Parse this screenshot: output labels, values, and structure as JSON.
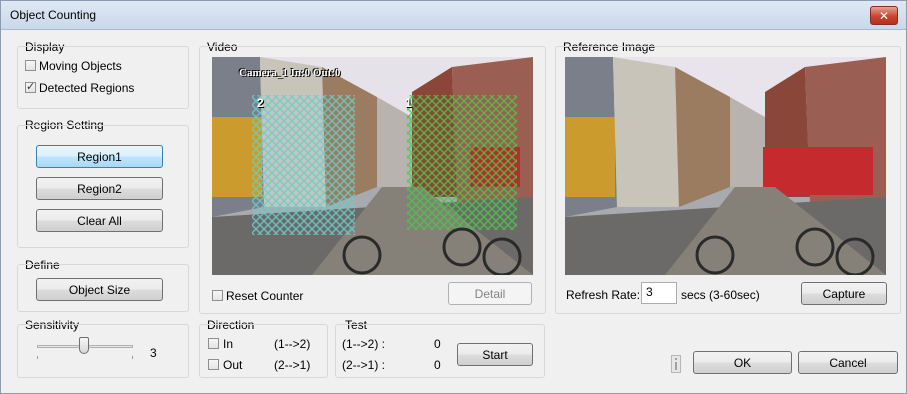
{
  "window": {
    "title": "Object Counting",
    "close_glyph": "✕"
  },
  "display": {
    "label": "Display",
    "moving_objects": "Moving Objects",
    "moving_checked": false,
    "detected_regions": "Detected Regions",
    "detected_checked": true
  },
  "region": {
    "label": "Region Setting",
    "region1": "Region1",
    "region2": "Region2",
    "clear_all": "Clear All"
  },
  "define": {
    "label": "Define",
    "object_size": "Object Size"
  },
  "sensitivity": {
    "label": "Sensitivity",
    "value": "3"
  },
  "video": {
    "label": "Video",
    "overlay_text": "Camera_1  In:0 Out:0",
    "region2_tag": "2",
    "region1_tag": "1",
    "reset_counter": "Reset Counter",
    "detail": "Detail"
  },
  "reference": {
    "label": "Reference Image",
    "refresh_label": "Refresh Rate:",
    "refresh_value": "3",
    "refresh_hint": "secs (3-60sec)",
    "capture": "Capture"
  },
  "direction": {
    "label": "Direction",
    "in_label": "In",
    "in_dir": "(1-->2)",
    "out_label": "Out",
    "out_dir": "(2-->1)"
  },
  "test": {
    "label": "Test",
    "row1_dir": "(1-->2) :",
    "row1_val": "0",
    "row2_dir": "(2-->1) :",
    "row2_val": "0",
    "start": "Start"
  },
  "footer": {
    "ok": "OK",
    "cancel": "Cancel"
  }
}
